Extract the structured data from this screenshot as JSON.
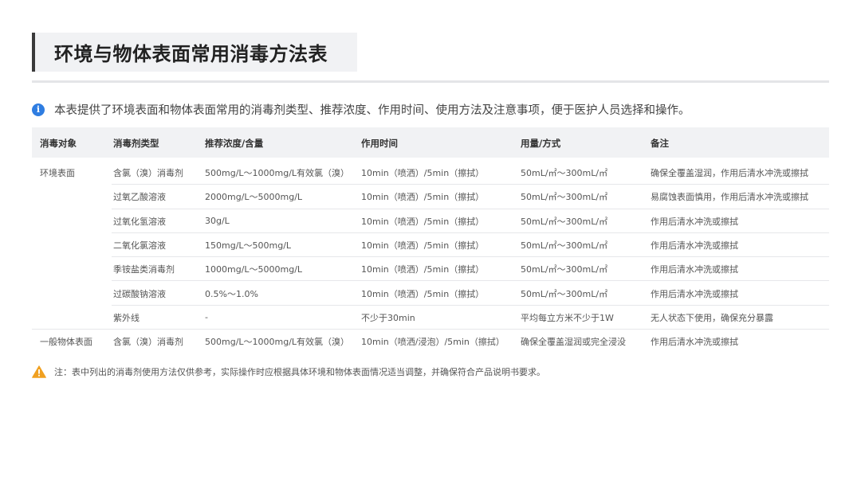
{
  "header": {
    "title": "环境与物体表面常用消毒方法表"
  },
  "intro": {
    "text": "本表提供了环境表面和物体表面常用的消毒剂类型、推荐浓度、作用时间、使用方法及注意事项，便于医护人员选择和操作。"
  },
  "table": {
    "columns": [
      "消毒对象",
      "消毒剂类型",
      "推荐浓度/含量",
      "作用时间",
      "用量/方式",
      "备注"
    ],
    "rows": [
      [
        "环境表面",
        "含氯（溴）消毒剂",
        "500mg/L～1000mg/L有效氯（溴）",
        "10min（喷洒）/5min（擦拭）",
        "50mL/㎡～300mL/㎡",
        "确保全覆盖湿润，作用后清水冲洗或擦拭"
      ],
      [
        "",
        "过氧乙酸溶液",
        "2000mg/L～5000mg/L",
        "10min（喷洒）/5min（擦拭）",
        "50mL/㎡～300mL/㎡",
        "易腐蚀表面慎用，作用后清水冲洗或擦拭"
      ],
      [
        "",
        "过氧化氢溶液",
        "30g/L",
        "10min（喷洒）/5min（擦拭）",
        "50mL/㎡～300mL/㎡",
        "作用后清水冲洗或擦拭"
      ],
      [
        "",
        "二氧化氯溶液",
        "150mg/L～500mg/L",
        "10min（喷洒）/5min（擦拭）",
        "50mL/㎡～300mL/㎡",
        "作用后清水冲洗或擦拭"
      ],
      [
        "",
        "季铵盐类消毒剂",
        "1000mg/L～5000mg/L",
        "10min（喷洒）/5min（擦拭）",
        "50mL/㎡～300mL/㎡",
        "作用后清水冲洗或擦拭"
      ],
      [
        "",
        "过碳酸钠溶液",
        "0.5%～1.0%",
        "10min（喷洒）/5min（擦拭）",
        "50mL/㎡～300mL/㎡",
        "作用后清水冲洗或擦拭"
      ],
      [
        "",
        "紫外线",
        "-",
        "不少于30min",
        "平均每立方米不少于1W",
        "无人状态下使用，确保充分暴露"
      ],
      [
        "一般物体表面",
        "含氯（溴）消毒剂",
        "500mg/L～1000mg/L有效氯（溴）",
        "10min（喷洒/浸泡）/5min（擦拭）",
        "确保全覆盖湿润或完全浸没",
        "作用后清水冲洗或擦拭"
      ]
    ]
  },
  "note": {
    "text": "注：表中列出的消毒剂使用方法仅供参考，实际操作时应根据具体环境和物体表面情况适当调整，并确保符合产品说明书要求。"
  },
  "icons": {
    "info": "info-icon",
    "warning": "warning-icon"
  },
  "colors": {
    "info_blue": "#2f7de1",
    "warning_orange": "#f0a020",
    "header_bg": "#f1f2f4"
  }
}
